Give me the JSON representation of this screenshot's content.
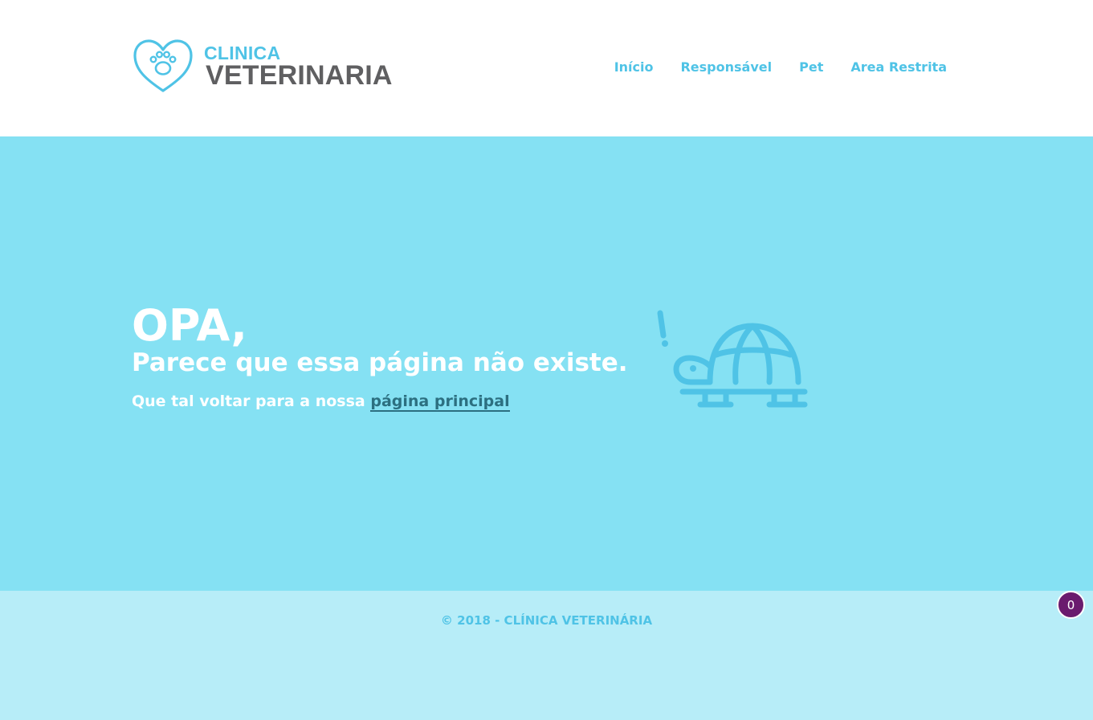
{
  "brand": {
    "line1": "CLINICA",
    "line2": "VETERINARIA",
    "icon": "heart-paw-icon",
    "color_primary": "#4fc3e6",
    "color_text": "#5f5f61"
  },
  "nav": {
    "items": [
      {
        "label": "Início"
      },
      {
        "label": "Responsável"
      },
      {
        "label": "Pet"
      },
      {
        "label": "Area Restrita"
      }
    ]
  },
  "hero": {
    "title": "OPA,",
    "subtitle": "Parece que essa página não existe.",
    "text": "Que tal voltar para a nossa",
    "link_label": "página principal",
    "illustration": "turtle-icon",
    "background": "#85e1f3",
    "link_color": "#2c6f80"
  },
  "footer": {
    "copyright": "© 2018 - CLÍNICA VETERINÁRIA",
    "background": "#b7edf8"
  },
  "badge": {
    "count": "0",
    "color": "#6a1b6e"
  }
}
